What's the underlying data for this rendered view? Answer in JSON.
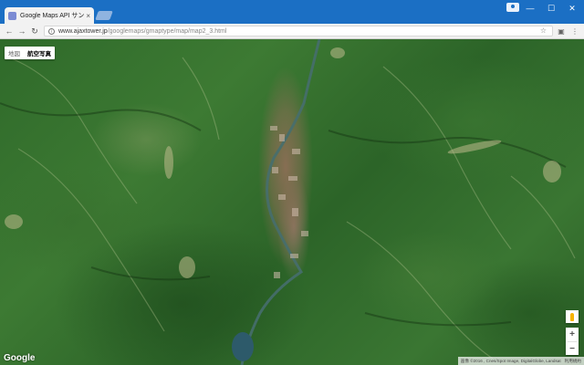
{
  "browser": {
    "tab_title": "Google Maps API サンプル",
    "tab_close": "×",
    "url_host": "www.ajaxtower.jp",
    "url_path": "/googlemaps/gmaptype/map/map2_3.html",
    "info_icon": "i",
    "icons": [
      "back-arrow-icon",
      "forward-arrow-icon",
      "reload-icon",
      "info-icon",
      "star-icon",
      "camera-icon",
      "menu-icon",
      "profile-icon"
    ],
    "back_glyph": "←",
    "forward_glyph": "→",
    "reload_glyph": "↻",
    "star_glyph": "☆",
    "camera_glyph": "▣",
    "menu_glyph": "⋮",
    "minimize_glyph": "—",
    "maximize_glyph": "☐",
    "close_glyph": "✕"
  },
  "map": {
    "maptype_buttons": [
      {
        "label": "地図",
        "active": false
      },
      {
        "label": "航空写真",
        "active": true
      }
    ],
    "zoom_in": "+",
    "zoom_out": "−",
    "logo": "Google",
    "attribution": "画像 ©2016 , Cnes/Spot Image, DigitalGlobe, Landsat",
    "terms": "利用規約",
    "accent": "#1b6fc4"
  }
}
